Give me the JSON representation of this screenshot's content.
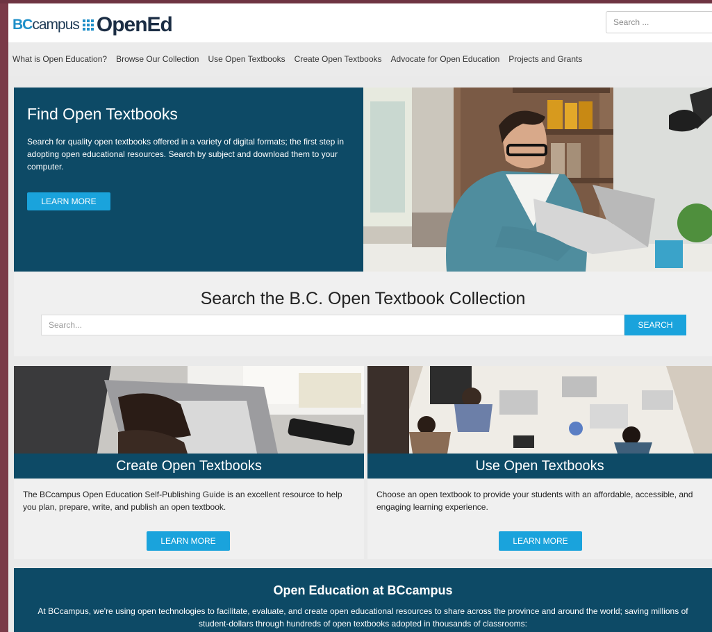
{
  "header": {
    "logo": {
      "bc": "BC",
      "campus": "campus",
      "opened": "OpenEd"
    },
    "search_placeholder": "Search ..."
  },
  "nav": {
    "items": [
      "What is Open Education?",
      "Browse Our Collection",
      "Use Open Textbooks",
      "Create Open Textbooks",
      "Advocate for Open Education",
      "Projects and Grants"
    ]
  },
  "hero": {
    "title": "Find Open Textbooks",
    "text": "Search for quality open textbooks offered in a variety of digital formats; the first step in adopting open educational resources. Search by subject and download them to your computer.",
    "button": "LEARN MORE"
  },
  "collection_search": {
    "title": "Search the B.C. Open Textbook Collection",
    "placeholder": "Search...",
    "button": "SEARCH"
  },
  "cards": [
    {
      "title": "Create Open Textbooks",
      "text": "The BCcampus Open Education Self-Publishing Guide is an excellent resource to help you plan, prepare, write, and publish an open textbook.",
      "button": "LEARN MORE"
    },
    {
      "title": "Use Open Textbooks",
      "text": "Choose an open textbook to provide your students with an affordable, accessible, and engaging learning experience.",
      "button": "LEARN MORE"
    }
  ],
  "footer": {
    "title": "Open Education at BCcampus",
    "text": "At BCcampus, we're using open technologies to facilitate, evaluate, and create open educational resources to share across the province and around the world; saving millions of student-dollars through hundreds of open textbooks adopted in thousands of classrooms:"
  },
  "colors": {
    "brand_dark": "#0d4a66",
    "accent_button": "#1aa3dc",
    "logo_blue": "#1e8fc8",
    "frame": "#7a3a48"
  }
}
